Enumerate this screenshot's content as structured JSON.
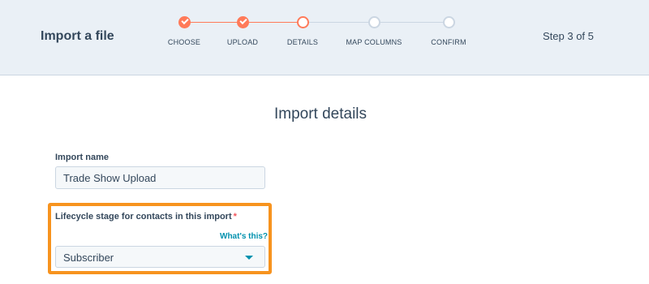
{
  "header": {
    "title": "Import a file",
    "step_indicator": "Step 3 of 5"
  },
  "stepper": {
    "steps": [
      {
        "label": "CHOOSE",
        "status": "done"
      },
      {
        "label": "UPLOAD",
        "status": "done"
      },
      {
        "label": "DETAILS",
        "status": "current"
      },
      {
        "label": "MAP COLUMNS",
        "status": "todo"
      },
      {
        "label": "CONFIRM",
        "status": "todo"
      }
    ]
  },
  "main": {
    "section_title": "Import details",
    "import_name": {
      "label": "Import name",
      "value": "Trade Show Upload"
    },
    "lifecycle": {
      "label": "Lifecycle stage for contacts in this import",
      "required_mark": "*",
      "help_link": "What's this?",
      "selected": "Subscriber"
    }
  },
  "colors": {
    "accent": "#ff7a59",
    "highlight": "#f7931e",
    "link": "#0091ae",
    "inactive": "#cbd6e2",
    "header_bg": "#eaf0f6"
  }
}
